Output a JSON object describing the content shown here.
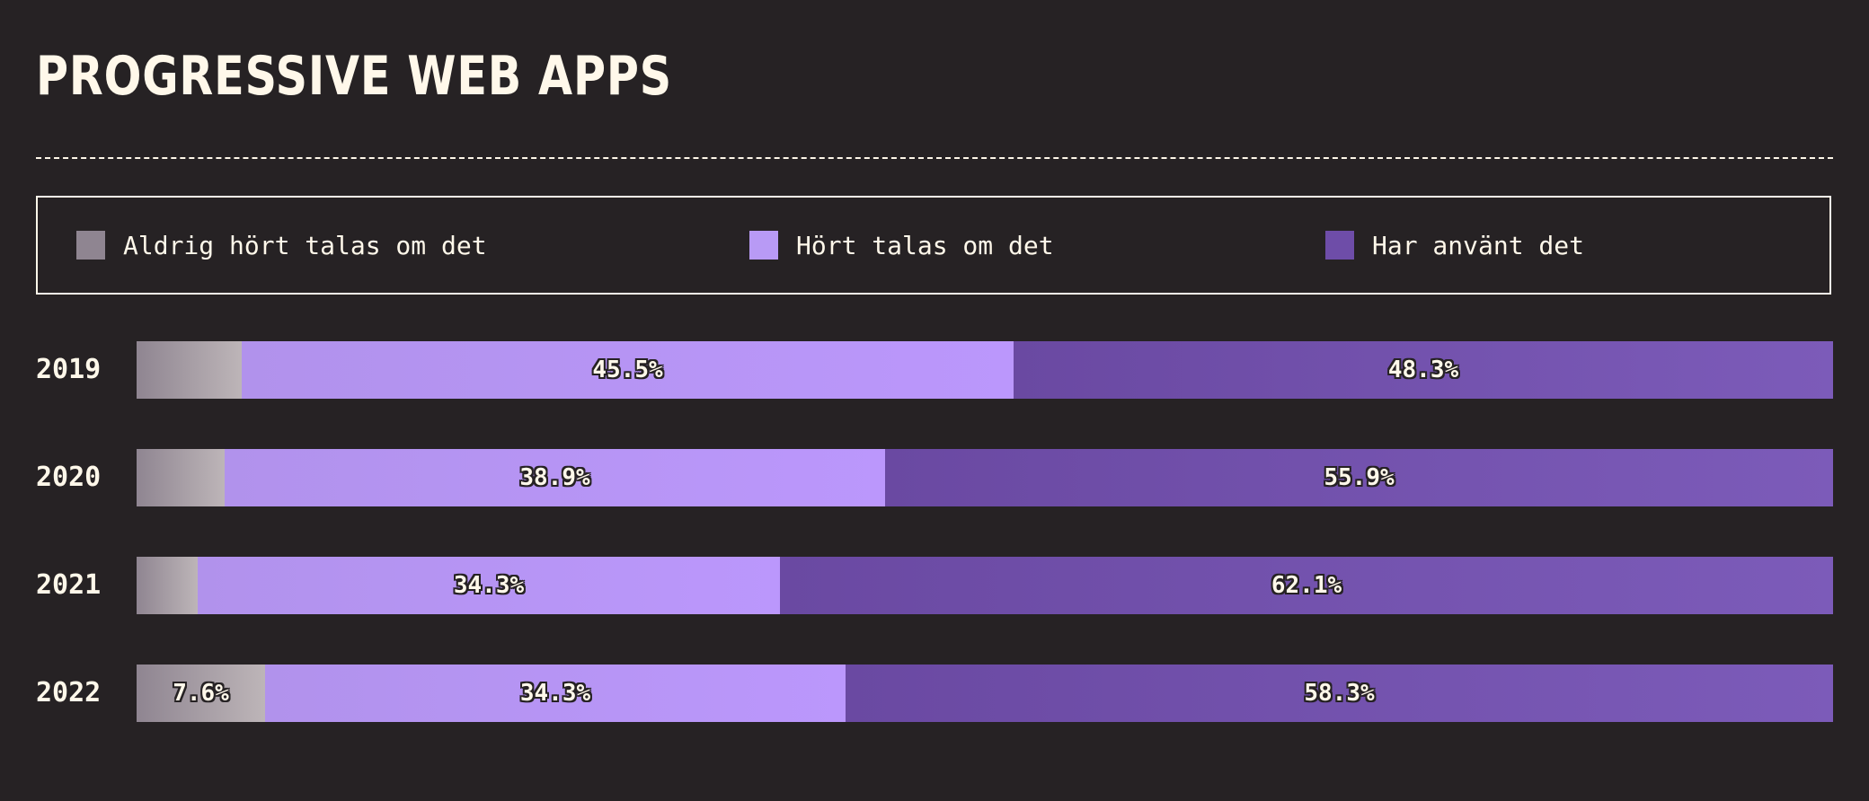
{
  "chart_data": {
    "type": "bar",
    "orientation": "horizontal",
    "stacked": true,
    "title": "PROGRESSIVE WEB APPS",
    "categories": [
      "2019",
      "2020",
      "2021",
      "2022"
    ],
    "series": [
      {
        "name": "Aldrig hört talas om det",
        "values": [
          6.2,
          5.2,
          3.6,
          7.6
        ],
        "color": "#8f8591",
        "labels": [
          "",
          "",
          "",
          "7.6%"
        ]
      },
      {
        "name": "Hört talas om det",
        "values": [
          45.5,
          38.9,
          34.3,
          34.3
        ],
        "color": "#b89af5",
        "labels": [
          "45.5%",
          "38.9%",
          "34.3%",
          "34.3%"
        ]
      },
      {
        "name": "Har använt det",
        "values": [
          48.3,
          55.9,
          62.1,
          58.3
        ],
        "color": "#6e4da8",
        "labels": [
          "48.3%",
          "55.9%",
          "62.1%",
          "58.3%"
        ]
      }
    ],
    "xlim": [
      0,
      100
    ],
    "legend": "top"
  }
}
